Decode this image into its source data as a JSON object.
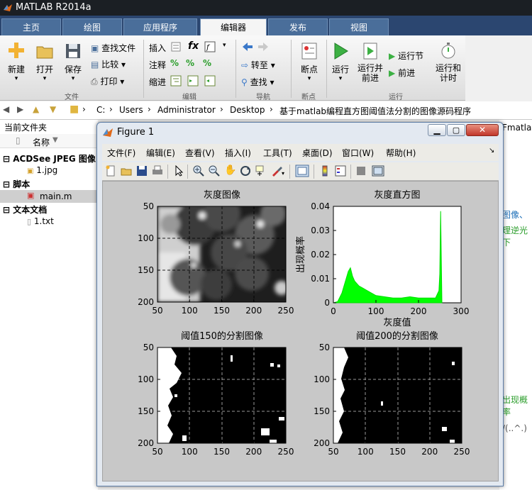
{
  "app_title": "MATLAB R2014a",
  "tabs": [
    "主页",
    "绘图",
    "应用程序",
    "编辑器",
    "发布",
    "视图"
  ],
  "ribbon": {
    "new": "新建",
    "open": "打开",
    "save": "保存",
    "find_files": "查找文件",
    "compare": "比较",
    "print": "打印",
    "insert": "插入",
    "fx": "fx",
    "comment": "注释",
    "indent": "缩进",
    "goto": "转至",
    "find": "查找",
    "breakpoint": "断点",
    "run": "运行",
    "run_advance": "运行并\n前进",
    "run_section": "运行节",
    "advance": "前进",
    "run_time": "运行和\n计时",
    "group_file": "文件",
    "group_edit": "编辑",
    "group_nav": "导航",
    "group_bp": "断点",
    "group_run": "运行"
  },
  "address": [
    "C:",
    "Users",
    "Administrator",
    "Desktop",
    "基于matlab编程直方图阈值法分割的图像源码程序"
  ],
  "current_folder": {
    "title": "当前文件夹",
    "col_name": "名称",
    "groups": [
      {
        "name": "ACDSee JPEG 图像",
        "files": [
          "1.jpg"
        ]
      },
      {
        "name": "脚本",
        "files": [
          "main.m"
        ]
      },
      {
        "name": "文本文档",
        "files": [
          "1.txt"
        ]
      }
    ]
  },
  "figure": {
    "title": "Figure 1",
    "menus": [
      "文件(F)",
      "编辑(E)",
      "查看(V)",
      "插入(I)",
      "工具(T)",
      "桌面(D)",
      "窗口(W)",
      "帮助(H)"
    ],
    "subplots": [
      {
        "title": "灰度图像",
        "xticks": [
          "50",
          "100",
          "150",
          "200",
          "250"
        ],
        "yticks": [
          "50",
          "100",
          "150",
          "200"
        ]
      },
      {
        "title": "灰度直方图",
        "xticks": [
          "0",
          "100",
          "200",
          "300"
        ],
        "yticks": [
          "0",
          "0.01",
          "0.02",
          "0.03",
          "0.04"
        ],
        "xlabel": "灰度值",
        "ylabel": "出现概率"
      },
      {
        "title": "阈值150的分割图像",
        "xticks": [
          "50",
          "100",
          "150",
          "200",
          "250"
        ],
        "yticks": [
          "50",
          "100",
          "150",
          "200"
        ]
      },
      {
        "title": "阈值200的分割图像",
        "xticks": [
          "50",
          "100",
          "150",
          "200",
          "250"
        ],
        "yticks": [
          "50",
          "100",
          "150",
          "200"
        ]
      }
    ]
  },
  "background_text": [
    "Fmatla",
    "图像、",
    "理逆光下",
    "出现概率",
    "/(..^.)"
  ],
  "chart_data": {
    "type": "area",
    "title": "灰度直方图",
    "xlabel": "灰度值",
    "ylabel": "出现概率",
    "xlim": [
      0,
      300
    ],
    "ylim": [
      0,
      0.04
    ],
    "color": "#00ff00",
    "x": [
      0,
      10,
      20,
      25,
      30,
      35,
      40,
      45,
      50,
      60,
      70,
      80,
      90,
      100,
      120,
      140,
      160,
      180,
      200,
      220,
      240,
      248,
      250,
      252,
      255
    ],
    "y": [
      0,
      0.0005,
      0.004,
      0.007,
      0.01,
      0.013,
      0.0145,
      0.011,
      0.009,
      0.007,
      0.006,
      0.005,
      0.004,
      0.003,
      0.0025,
      0.002,
      0.002,
      0.0025,
      0.002,
      0.002,
      0.002,
      0.005,
      0.012,
      0.038,
      0.0
    ]
  }
}
